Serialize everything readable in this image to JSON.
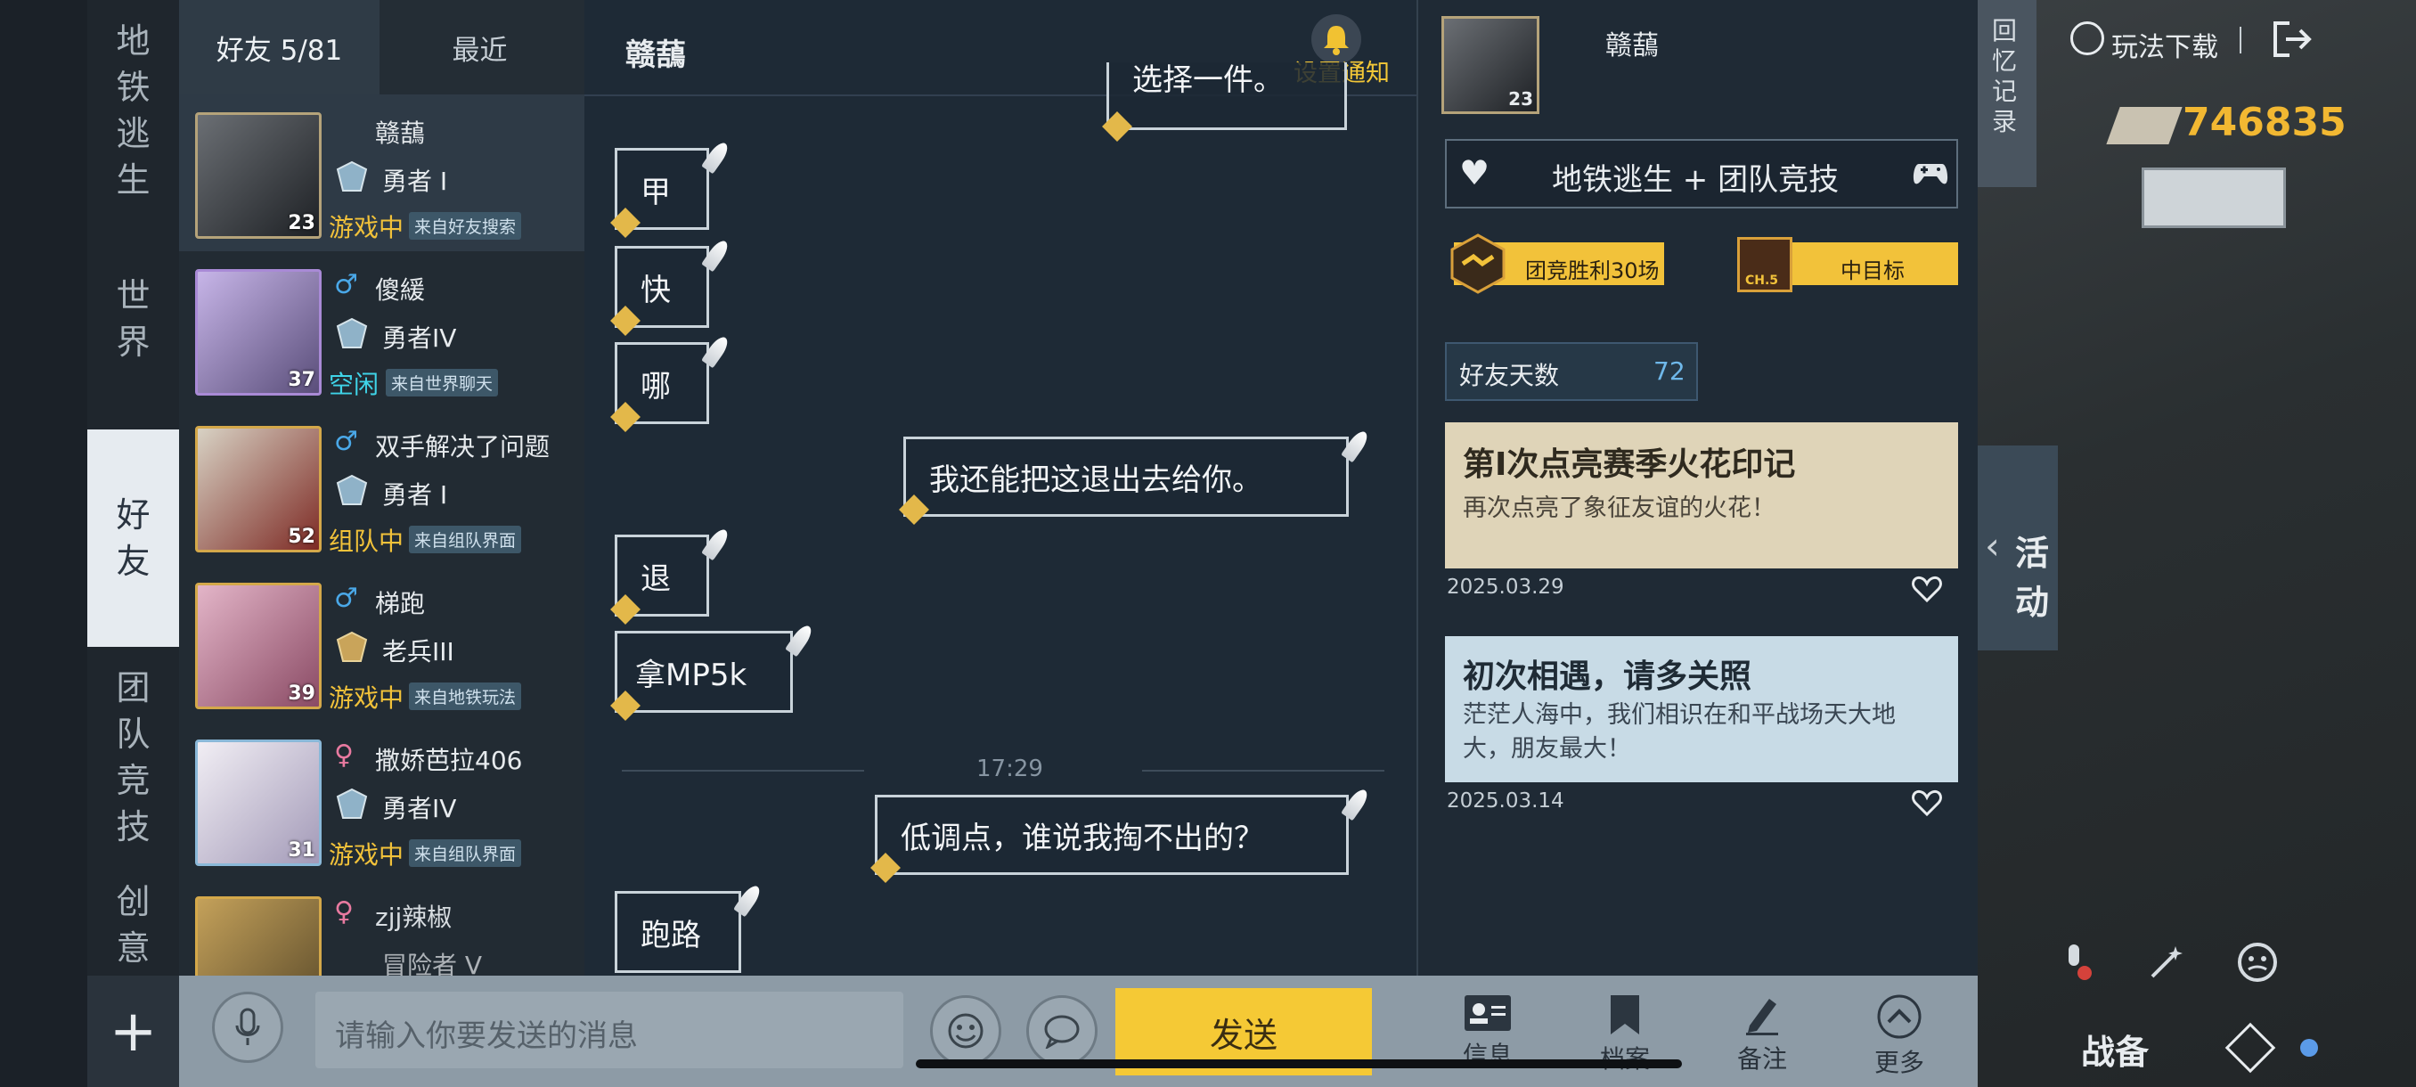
{
  "left_tabs": [
    "地铁逃生",
    "世界",
    "好友",
    "团队竞技",
    "创意"
  ],
  "friend_tabs": {
    "friends": "好友 5/81",
    "recent": "最近"
  },
  "friends": [
    {
      "name": "赣䕵",
      "level": "23",
      "gender": "",
      "rank": "勇者 I",
      "status": "游戏中",
      "status_color": "#f2c23a",
      "source": "来自好友搜索"
    },
    {
      "name": "傻緩",
      "level": "37",
      "gender": "♂",
      "rank": "勇者IV",
      "status": "空闲",
      "status_color": "#3fd4e8",
      "source": "来自世界聊天"
    },
    {
      "name": "双手解决了问题",
      "level": "52",
      "gender": "♂",
      "rank": "勇者 I",
      "status": "组队中",
      "status_color": "#f2c23a",
      "source": "来自组队界面"
    },
    {
      "name": "梯跑",
      "level": "39",
      "gender": "♂",
      "rank": "老兵III",
      "status": "游戏中",
      "status_color": "#f2c23a",
      "source": "来自地铁玩法"
    },
    {
      "name": "撒娇芭拉406",
      "level": "31",
      "gender": "♀",
      "rank": "勇者IV",
      "status": "游戏中",
      "status_color": "#f2c23a",
      "source": "来自组队界面"
    },
    {
      "name": "zjj辣椒",
      "level": "",
      "gender": "♀",
      "rank": "冒险者 V",
      "status": "",
      "status_color": "#f2c23a",
      "source": ""
    }
  ],
  "chat": {
    "title": "赣䕵",
    "notify_label": "设置通知",
    "partial_top": "选择一件。",
    "messages_left_1": [
      "甲",
      "快",
      "哪"
    ],
    "message_right_1": "我还能把这退出去给你。",
    "messages_left_2": [
      "退",
      "拿MP5k"
    ],
    "time": "17:29",
    "message_right_2": "低调点，谁说我掏不出的？",
    "message_left_3": "跑路"
  },
  "panel": {
    "name": "赣䕵",
    "level": "23",
    "mode": "地铁逃生 + 团队竞技",
    "badge1": "团竞胜利30场",
    "badge2": "中目标",
    "badge2_sub": "CH.5",
    "friend_days_label": "好友天数",
    "friend_days": "72",
    "memory1": {
      "title": "第I次点亮赛季火花印记",
      "text": "再次点亮了象征友谊的火花！",
      "date": "2025.03.29"
    },
    "memory2": {
      "title": "初次相遇，请多关照",
      "text": "茫茫人海中，我们相识在和平战场天大地大，朋友最大！",
      "date": "2025.03.14"
    },
    "actions": [
      "信息",
      "档案",
      "备注",
      "更多"
    ]
  },
  "bottom": {
    "add": "+",
    "placeholder": "请输入你要发送的消息",
    "send": "发送"
  },
  "hud": {
    "memory_tab": "回忆记录",
    "download": "玩法下载",
    "currency": "746835",
    "activity": "活动",
    "battle": "战备"
  },
  "colors": {
    "accent": "#f5c935",
    "highlight_tab": "#e6ebf0",
    "currency": "#f2b832"
  }
}
